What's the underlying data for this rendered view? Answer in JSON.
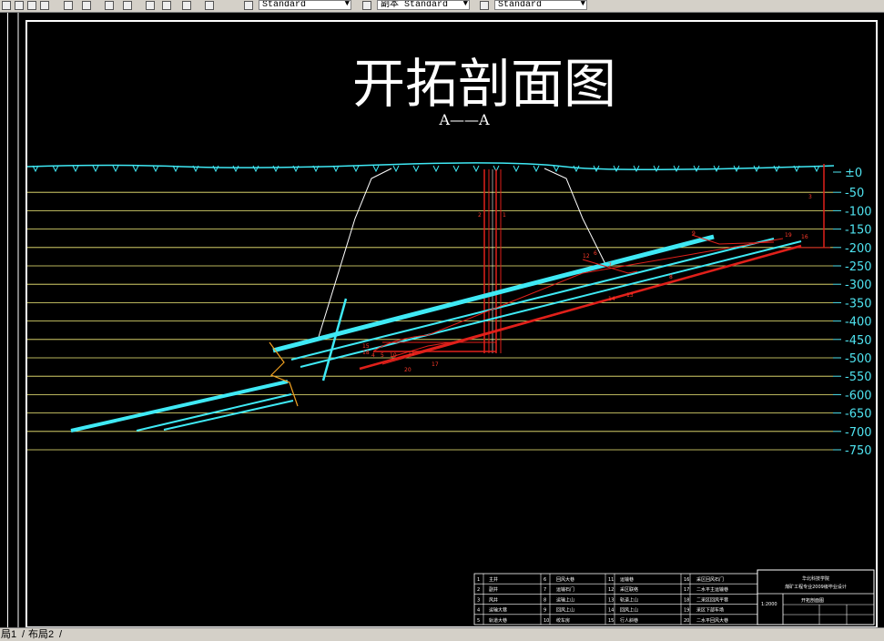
{
  "toolbar": {
    "text_style": "Standard",
    "dim_style": "副本 Standard",
    "table_style": "Standard"
  },
  "drawing": {
    "title": "开拓剖面图",
    "section_label": "A——A",
    "levels": [
      "±0",
      "-50",
      "-100",
      "-150",
      "-200",
      "-250",
      "-300",
      "-350",
      "-400",
      "-450",
      "-500",
      "-550",
      "-600",
      "-650",
      "-700",
      "-750"
    ],
    "colors": {
      "background": "#000000",
      "level_line": "#f5f07a",
      "seam": "#3fe9f5",
      "roadway": "#e0201a",
      "boundary": "#ffffff",
      "surface": "#3fe9f5"
    },
    "legend_rows": [
      [
        "1",
        "主井",
        "6",
        "回风大巷",
        "11",
        "运输巷",
        "16",
        "采区回风石门"
      ],
      [
        "2",
        "副井",
        "7",
        "运输石门",
        "12",
        "采区联络",
        "17",
        "二水平主运输巷"
      ],
      [
        "3",
        "风井",
        "8",
        "运输上山",
        "13",
        "轨道上山",
        "18",
        "二采区回风平巷"
      ],
      [
        "4",
        "运输大巷",
        "9",
        "回风上山",
        "14",
        "回风上山",
        "19",
        "采区下部车场"
      ],
      [
        "5",
        "轨道大巷",
        "10",
        "绞车房",
        "15",
        "行人斜巷",
        "20",
        "二水平回风大巷"
      ]
    ],
    "title_block": {
      "school": "华北科技学院",
      "subtitle": "煤矿工程专业2009级毕业设计",
      "drawing_name": "开拓剖面图",
      "scale": "1:2000"
    },
    "roadway_numbers": [
      "1",
      "2",
      "3",
      "4",
      "5",
      "6",
      "7",
      "8",
      "9",
      "10",
      "11",
      "12",
      "13",
      "14",
      "15",
      "16",
      "17",
      "18",
      "19",
      "20"
    ]
  },
  "layout_tabs": {
    "model": "局1",
    "layout2": "布局2"
  }
}
